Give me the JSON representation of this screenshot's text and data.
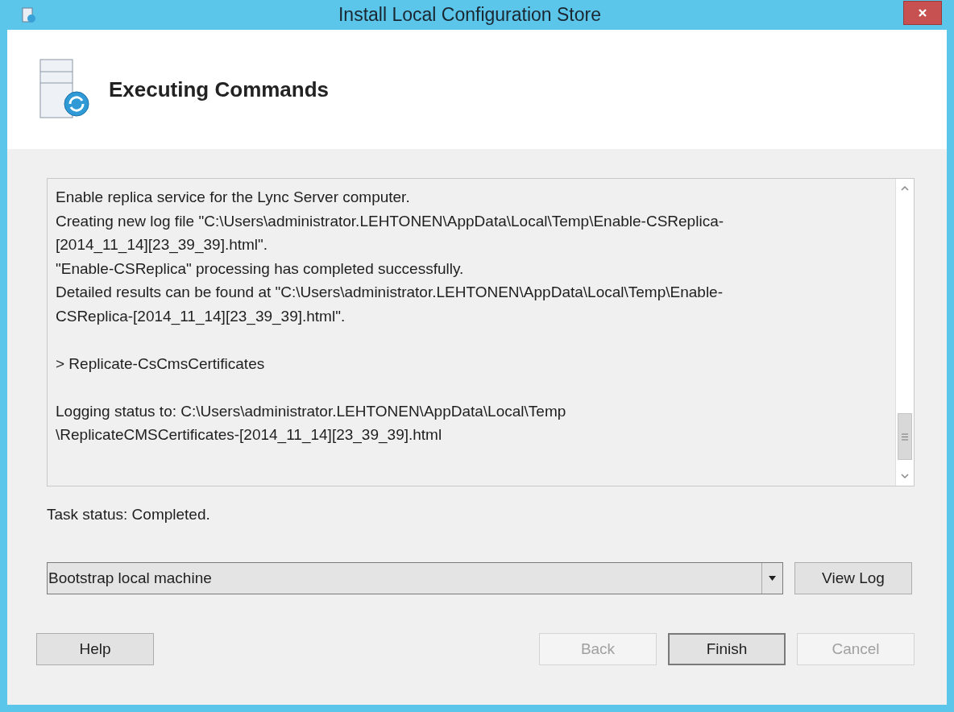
{
  "window": {
    "title": "Install Local Configuration Store"
  },
  "header": {
    "title": "Executing Commands"
  },
  "log": {
    "paragraphs": [
      [
        "Enable replica service for the Lync Server computer.",
        "Creating new log file \"C:\\Users\\administrator.LEHTONEN\\AppData\\Local\\Temp\\Enable-CSReplica-",
        "[2014_11_14][23_39_39].html\".",
        "\"Enable-CSReplica\" processing has completed successfully.",
        "Detailed results can be found at \"C:\\Users\\administrator.LEHTONEN\\AppData\\Local\\Temp\\Enable-",
        "CSReplica-[2014_11_14][23_39_39].html\"."
      ],
      [
        "> Replicate-CsCmsCertificates"
      ],
      [
        "Logging status to: C:\\Users\\administrator.LEHTONEN\\AppData\\Local\\Temp",
        "\\ReplicateCMSCertificates-[2014_11_14][23_39_39].html"
      ]
    ]
  },
  "task_status": "Task status: Completed.",
  "dropdown": {
    "value": "Bootstrap local machine"
  },
  "view_log_button": {
    "label": "View Log",
    "disabled": false
  },
  "buttons": [
    {
      "label": "Help",
      "disabled": false,
      "default": false
    },
    {
      "label": "Back",
      "disabled": true,
      "default": false
    },
    {
      "label": "Finish",
      "disabled": false,
      "default": true
    },
    {
      "label": "Cancel",
      "disabled": true,
      "default": false
    }
  ]
}
